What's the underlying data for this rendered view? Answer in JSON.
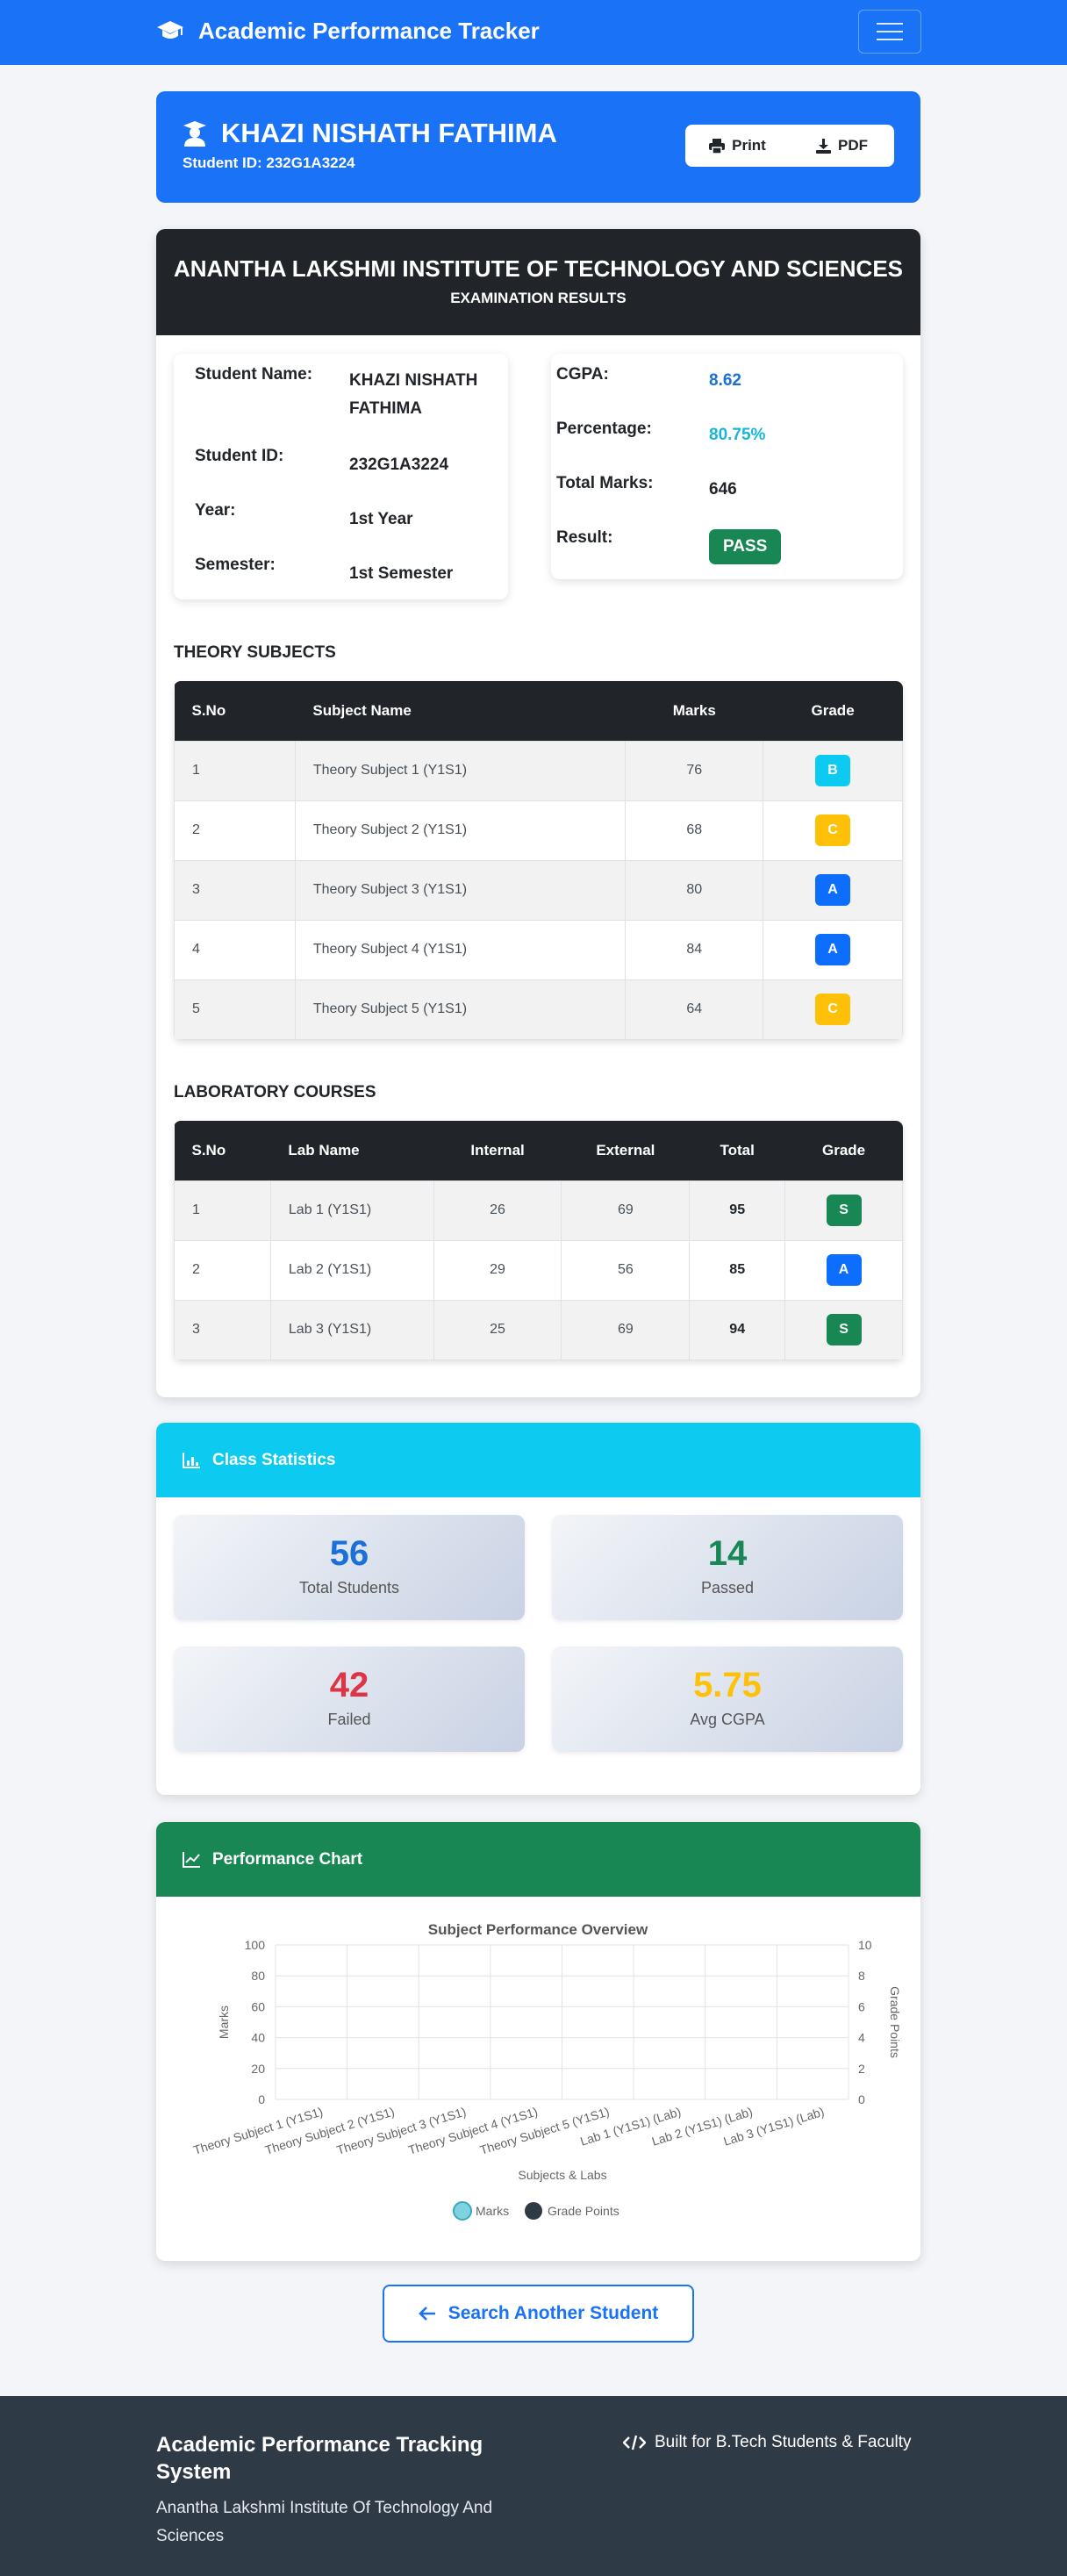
{
  "navbar": {
    "title": "Academic Performance Tracker",
    "brand_icon": "graduation-cap-icon",
    "toggle_icon": "hamburger-icon"
  },
  "student_header": {
    "name": "KHAZI NISHATH FATHIMA",
    "id_label": "Student ID: 232G1A3224",
    "print_label": "Print",
    "pdf_label": "PDF"
  },
  "results": {
    "institute": "ANANTHA LAKSHMI INSTITUTE OF TECHNOLOGY AND SCIENCES",
    "exam_label": "EXAMINATION RESULTS",
    "student": {
      "name_label": "Student Name:",
      "name_line1": "KHAZI NISHATH",
      "name_line2": "FATHIMA",
      "id_label": "Student ID:",
      "id": "232G1A3224",
      "year_label": "Year:",
      "year": "1st Year",
      "semester_label": "Semester:",
      "semester": "1st Semester"
    },
    "summary": {
      "cgpa_label": "CGPA:",
      "cgpa": "8.62",
      "percentage_label": "Percentage:",
      "percentage": "80.75%",
      "total_label": "Total Marks:",
      "total": "646",
      "result_label": "Result:",
      "result": "PASS"
    },
    "theory": {
      "title": "THEORY SUBJECTS",
      "headers": [
        "S.No",
        "Subject Name",
        "Marks",
        "Grade"
      ],
      "rows": [
        {
          "sno": "1",
          "name": "Theory Subject 1 (Y1S1)",
          "marks": "76",
          "grade": "B"
        },
        {
          "sno": "2",
          "name": "Theory Subject 2 (Y1S1)",
          "marks": "68",
          "grade": "C"
        },
        {
          "sno": "3",
          "name": "Theory Subject 3 (Y1S1)",
          "marks": "80",
          "grade": "A"
        },
        {
          "sno": "4",
          "name": "Theory Subject 4 (Y1S1)",
          "marks": "84",
          "grade": "A"
        },
        {
          "sno": "5",
          "name": "Theory Subject 5 (Y1S1)",
          "marks": "64",
          "grade": "C"
        }
      ]
    },
    "labs": {
      "title": "LABORATORY COURSES",
      "headers": [
        "S.No",
        "Lab Name",
        "Internal",
        "External",
        "Total",
        "Grade"
      ],
      "rows": [
        {
          "sno": "1",
          "name": "Lab 1 (Y1S1)",
          "internal": "26",
          "external": "69",
          "total": "95",
          "grade": "S"
        },
        {
          "sno": "2",
          "name": "Lab 2 (Y1S1)",
          "internal": "29",
          "external": "56",
          "total": "85",
          "grade": "A"
        },
        {
          "sno": "3",
          "name": "Lab 3 (Y1S1)",
          "internal": "25",
          "external": "69",
          "total": "94",
          "grade": "S"
        }
      ]
    },
    "grade_colors": {
      "S": "#198754",
      "A": "#0d6efd",
      "B": "#0dcaf0",
      "C": "#ffc107"
    }
  },
  "stats": {
    "title": "Class Statistics",
    "header_color": "#0dcaf0",
    "items": [
      {
        "value": "56",
        "label": "Total Students",
        "color": "#1a6fd8"
      },
      {
        "value": "14",
        "label": "Passed",
        "color": "#198754"
      },
      {
        "value": "42",
        "label": "Failed",
        "color": "#dc3545"
      },
      {
        "value": "5.75",
        "label": "Avg CGPA",
        "color": "#ffc107"
      }
    ]
  },
  "chart": {
    "card_title": "Performance Chart",
    "header_color": "#198754"
  },
  "chart_data": {
    "type": "line",
    "title": "Subject Performance Overview",
    "xlabel": "Subjects & Labs",
    "ylabel": "Marks",
    "y2label": "Grade Points",
    "categories": [
      "Theory Subject 1 (Y1S1)",
      "Theory Subject 2 (Y1S1)",
      "Theory Subject 3 (Y1S1)",
      "Theory Subject 4 (Y1S1)",
      "Theory Subject 5 (Y1S1)",
      "Lab 1 (Y1S1) (Lab)",
      "Lab 2 (Y1S1) (Lab)",
      "Lab 3 (Y1S1) (Lab)"
    ],
    "ylim": [
      0,
      100
    ],
    "y2lim": [
      0,
      10
    ],
    "yticks": [
      "0",
      "20",
      "40",
      "60",
      "80",
      "100"
    ],
    "y2ticks": [
      "0",
      "2",
      "4",
      "6",
      "8",
      "10"
    ],
    "series": [
      {
        "name": "Marks",
        "values": [],
        "color": "#7fd3e0"
      },
      {
        "name": "Grade Points",
        "values": [],
        "color": "#2f3a47"
      }
    ],
    "grid": true,
    "legend": "bottom"
  },
  "search_button": {
    "label": "Search Another Student"
  },
  "footer": {
    "title": "Academic Performance Tracking System",
    "subtitle": "Anantha Lakshmi Institute Of Technology And Sciences",
    "right_text": "Built for B.Tech Students & Faculty"
  }
}
